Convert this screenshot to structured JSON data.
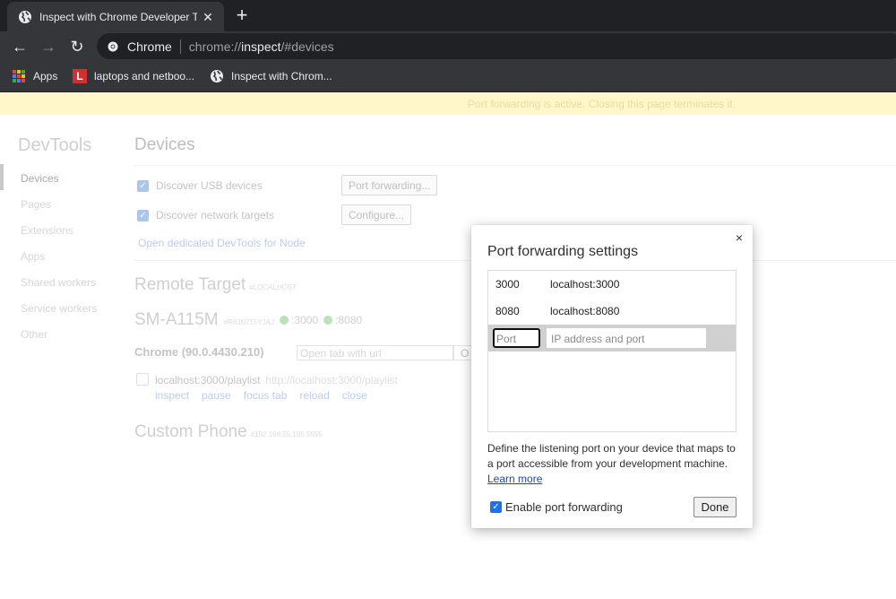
{
  "browser": {
    "tab_title": "Inspect with Chrome Developer Tools",
    "new_tab_glyph": "+",
    "close_glyph": "✕",
    "omnibox": {
      "scheme_label": "Chrome",
      "url_prefix": "chrome://",
      "url_host": "inspect",
      "url_suffix": "/#devices"
    },
    "nav": {
      "back": "←",
      "forward": "→",
      "reload": "↻"
    },
    "bookmarks": [
      {
        "label": "Apps",
        "icon": "apps-grid-icon"
      },
      {
        "label": "laptops and netboo...",
        "icon": "l-favicon-icon",
        "icon_letter": "L"
      },
      {
        "label": "Inspect with Chrom...",
        "icon": "globe-icon"
      }
    ]
  },
  "banner": {
    "text": "Port forwarding is active. Closing this page terminates it."
  },
  "sidebar": {
    "title": "DevTools",
    "items": [
      "Devices",
      "Pages",
      "Extensions",
      "Apps",
      "Shared workers",
      "Service workers",
      "Other"
    ],
    "selected": "Devices"
  },
  "main": {
    "title": "Devices",
    "discover_usb": "Discover USB devices",
    "port_forwarding_btn": "Port forwarding...",
    "discover_network": "Discover network targets",
    "configure_btn": "Configure...",
    "node_link": "Open dedicated DevTools for Node",
    "remote_target": {
      "title": "Remote Target",
      "sub": "#LOCALHOST"
    },
    "device": {
      "name": "SM-A115M",
      "serial": "#R8JN715YJAJ",
      "ports": [
        ":3000",
        ":8080"
      ]
    },
    "browser_name": "Chrome (90.0.4430.210)",
    "open_tab_placeholder": "Open tab with url",
    "open_btn": "O",
    "page_entry": {
      "title": "localhost:3000/playlist",
      "url": "http://localhost:3000/playlist"
    },
    "actions": [
      "inspect",
      "pause",
      "focus tab",
      "reload",
      "close"
    ],
    "custom_phone": {
      "title": "Custom Phone",
      "sub": "#192.168.55.105:5555"
    }
  },
  "dialog": {
    "title": "Port forwarding settings",
    "close_glyph": "×",
    "rules": [
      {
        "port": "3000",
        "target": "localhost:3000"
      },
      {
        "port": "8080",
        "target": "localhost:8080"
      }
    ],
    "port_placeholder": "Port",
    "address_placeholder": "IP address and port",
    "help_text": "Define the listening port on your device that maps to a port accessible from your development machine.",
    "learn_more": "Learn more",
    "enable_label": "Enable port forwarding",
    "enable_checked": true,
    "done_label": "Done"
  }
}
